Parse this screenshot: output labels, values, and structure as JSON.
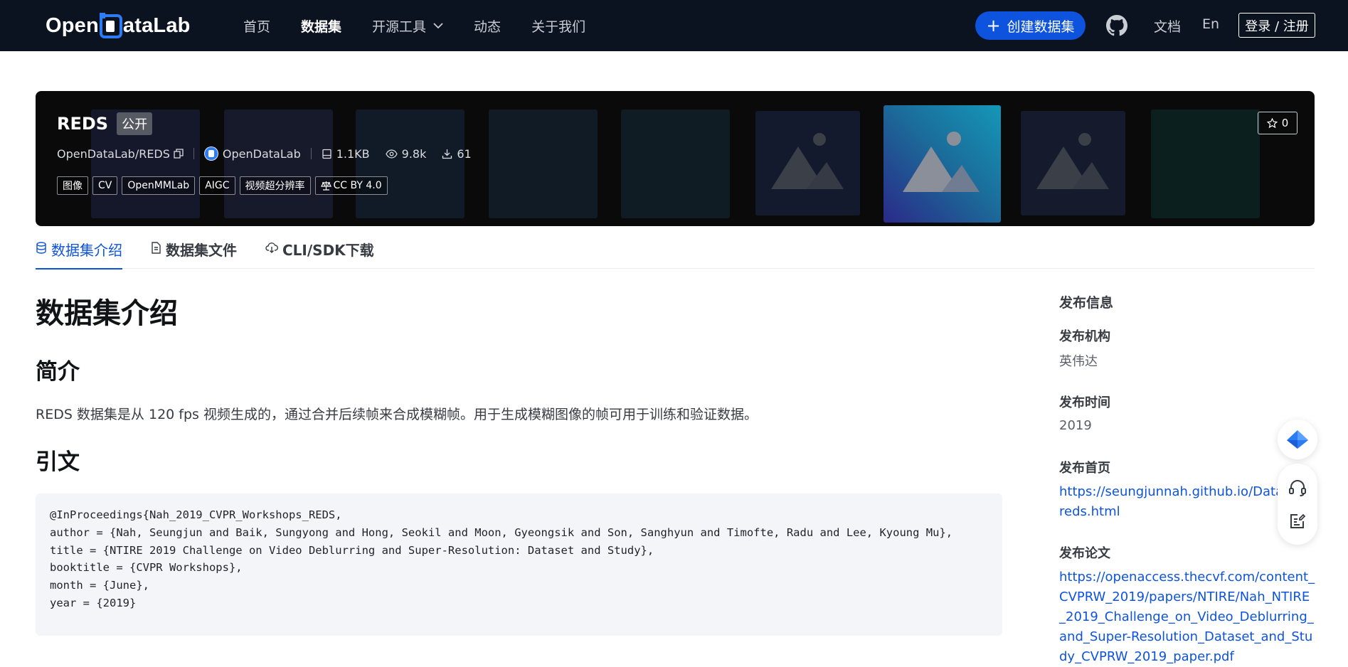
{
  "colors": {
    "nav_bg": "#0b1220",
    "accent": "#0d53de",
    "banner_bg": "#0a0a0a"
  },
  "nav": {
    "logo_left": "Open",
    "logo_right": "ataLab",
    "items": [
      {
        "label": "首页"
      },
      {
        "label": "数据集"
      },
      {
        "label": "开源工具"
      },
      {
        "label": "动态"
      },
      {
        "label": "关于我们"
      }
    ],
    "create_button": "创建数据集",
    "docs": "文档",
    "lang": "En",
    "login": "登录 / 注册"
  },
  "banner": {
    "name": "REDS",
    "visibility": "公开",
    "path": "OpenDataLab/REDS",
    "org": "OpenDataLab",
    "size": "1.1KB",
    "views": "9.8k",
    "downloads": "61",
    "tags": [
      "图像",
      "CV",
      "OpenMMLab",
      "AIGC",
      "视频超分辨率"
    ],
    "license": "CC BY 4.0",
    "stars": "0"
  },
  "tabs": [
    {
      "label": "数据集介绍"
    },
    {
      "label": "数据集文件"
    },
    {
      "label": "CLI/SDK下载"
    }
  ],
  "content": {
    "heading": "数据集介绍",
    "intro_heading": "简介",
    "intro_text": "REDS 数据集是从 120 fps 视频生成的，通过合并后续帧来合成模糊帧。用于生成模糊图像的帧可用于训练和验证数据。",
    "citation_heading": "引文",
    "citation_lines": [
      "@InProceedings{Nah_2019_CVPR_Workshops_REDS,",
      "author = {Nah, Seungjun and Baik, Sungyong and Hong, Seokil and Moon, Gyeongsik and Son, Sanghyun and Timofte, Radu and Lee, Kyoung Mu},",
      "title = {NTIRE 2019 Challenge on Video Deblurring and Super-Resolution: Dataset and Study},",
      "booktitle = {CVPR Workshops},",
      "month = {June},",
      "year = {2019}"
    ]
  },
  "sidebar": {
    "title": "发布信息",
    "org_label": "发布机构",
    "org_value": "英伟达",
    "time_label": "发布时间",
    "time_value": "2019",
    "home_label": "发布首页",
    "home_link": "https://seungjunnah.github.io/Datasets/reds.html",
    "paper_label": "发布论文",
    "paper_link": "https://openaccess.thecvf.com/content_CVPRW_2019/papers/NTIRE/Nah_NTIRE_2019_Challenge_on_Video_Deblurring_and_Super-Resolution_Dataset_and_Study_CVPRW_2019_paper.pdf"
  },
  "icons": {
    "nav": [
      "chevron-down-icon",
      "plus-icon",
      "github-icon"
    ],
    "banner": [
      "copy-icon",
      "opendatalab-logo-icon",
      "storage-icon",
      "eye-icon",
      "download-icon",
      "scale-icon",
      "star-icon",
      "image-placeholder-icon"
    ],
    "tabs": [
      "database-icon",
      "file-icon",
      "cloud-download-icon"
    ],
    "float": [
      "bird-icon",
      "headset-icon",
      "edit-note-icon"
    ]
  }
}
